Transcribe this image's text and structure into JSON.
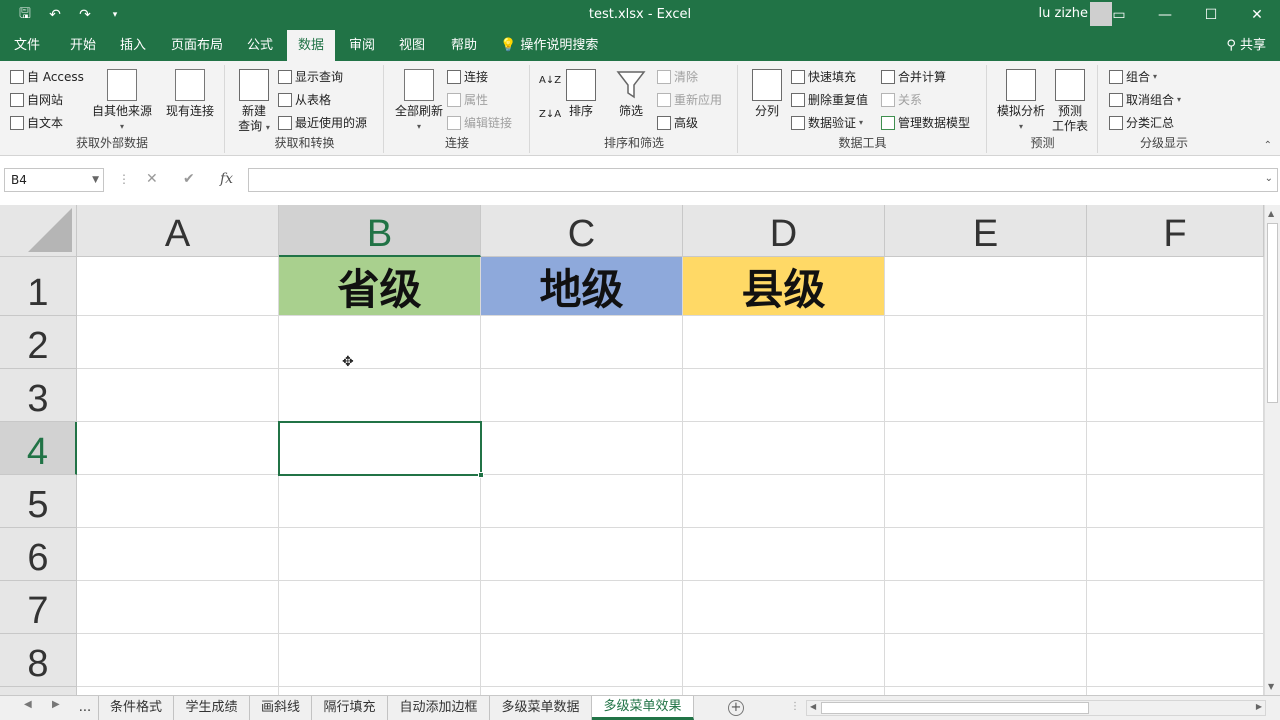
{
  "titlebar": {
    "title": "test.xlsx  -  Excel",
    "user": "lu zizhe",
    "qat": {
      "save": "🖫",
      "undo": "↶",
      "redo": "↷",
      "customize": "▾"
    },
    "controls": {
      "ribbon_display": "▭",
      "minimize": "—",
      "maximize": "☐",
      "close": "✕"
    }
  },
  "tabs": [
    "文件",
    "开始",
    "插入",
    "页面布局",
    "公式",
    "数据",
    "审阅",
    "视图",
    "帮助",
    "操作说明搜索"
  ],
  "share_label": "共享",
  "ribbon": {
    "group1": {
      "label": "获取外部数据",
      "access": "自 Access",
      "web": "自网站",
      "text": "自文本",
      "other": "自其他来源",
      "existing": "现有连接"
    },
    "group2": {
      "label": "获取和转换",
      "new_query": "新建",
      "new_query2": "查询",
      "show_queries": "显示查询",
      "from_table": "从表格",
      "recent_sources": "最近使用的源"
    },
    "group3": {
      "label": "连接",
      "refresh_all": "全部刷新",
      "connections": "连接",
      "properties": "属性",
      "edit_links": "编辑链接"
    },
    "group4": {
      "label": "排序和筛选",
      "sort_az": "A↓Z",
      "sort_za": "Z↓A",
      "sort": "排序",
      "filter": "筛选",
      "clear": "清除",
      "reapply": "重新应用",
      "advanced": "高级"
    },
    "group5": {
      "label": "数据工具",
      "text_to_columns": "分列",
      "flash_fill": "快速填充",
      "remove_duplicates": "删除重复值",
      "data_validation": "数据验证",
      "consolidate": "合并计算",
      "relationships": "关系",
      "manage_model": "管理数据模型"
    },
    "group6": {
      "label": "预测",
      "what_if": "模拟分析",
      "forecast": "预测",
      "forecast2": "工作表"
    },
    "group7": {
      "label": "分级显示",
      "group": "组合",
      "ungroup": "取消组合",
      "subtotal": "分类汇总"
    }
  },
  "formula_bar": {
    "name_box": "B4",
    "cancel": "✕",
    "enter": "✔",
    "fx": "fx",
    "value": ""
  },
  "columns": [
    "A",
    "B",
    "C",
    "D",
    "E",
    "F"
  ],
  "rows": [
    "1",
    "2",
    "3",
    "4",
    "5",
    "6",
    "7",
    "8"
  ],
  "cells": {
    "B1": "省级",
    "C1": "地级",
    "D1": "县级"
  },
  "colors": {
    "accent": "#217346",
    "B1_fill": "#A9D08E",
    "C1_fill": "#8EA9DB",
    "D1_fill": "#FFD966"
  },
  "sheets": [
    "...",
    "条件格式",
    "学生成绩",
    "画斜线",
    "隔行填充",
    "自动添加边框",
    "多级菜单数据",
    "多级菜单效果"
  ],
  "active_sheet": "多级菜单效果",
  "add_sheet": "+"
}
